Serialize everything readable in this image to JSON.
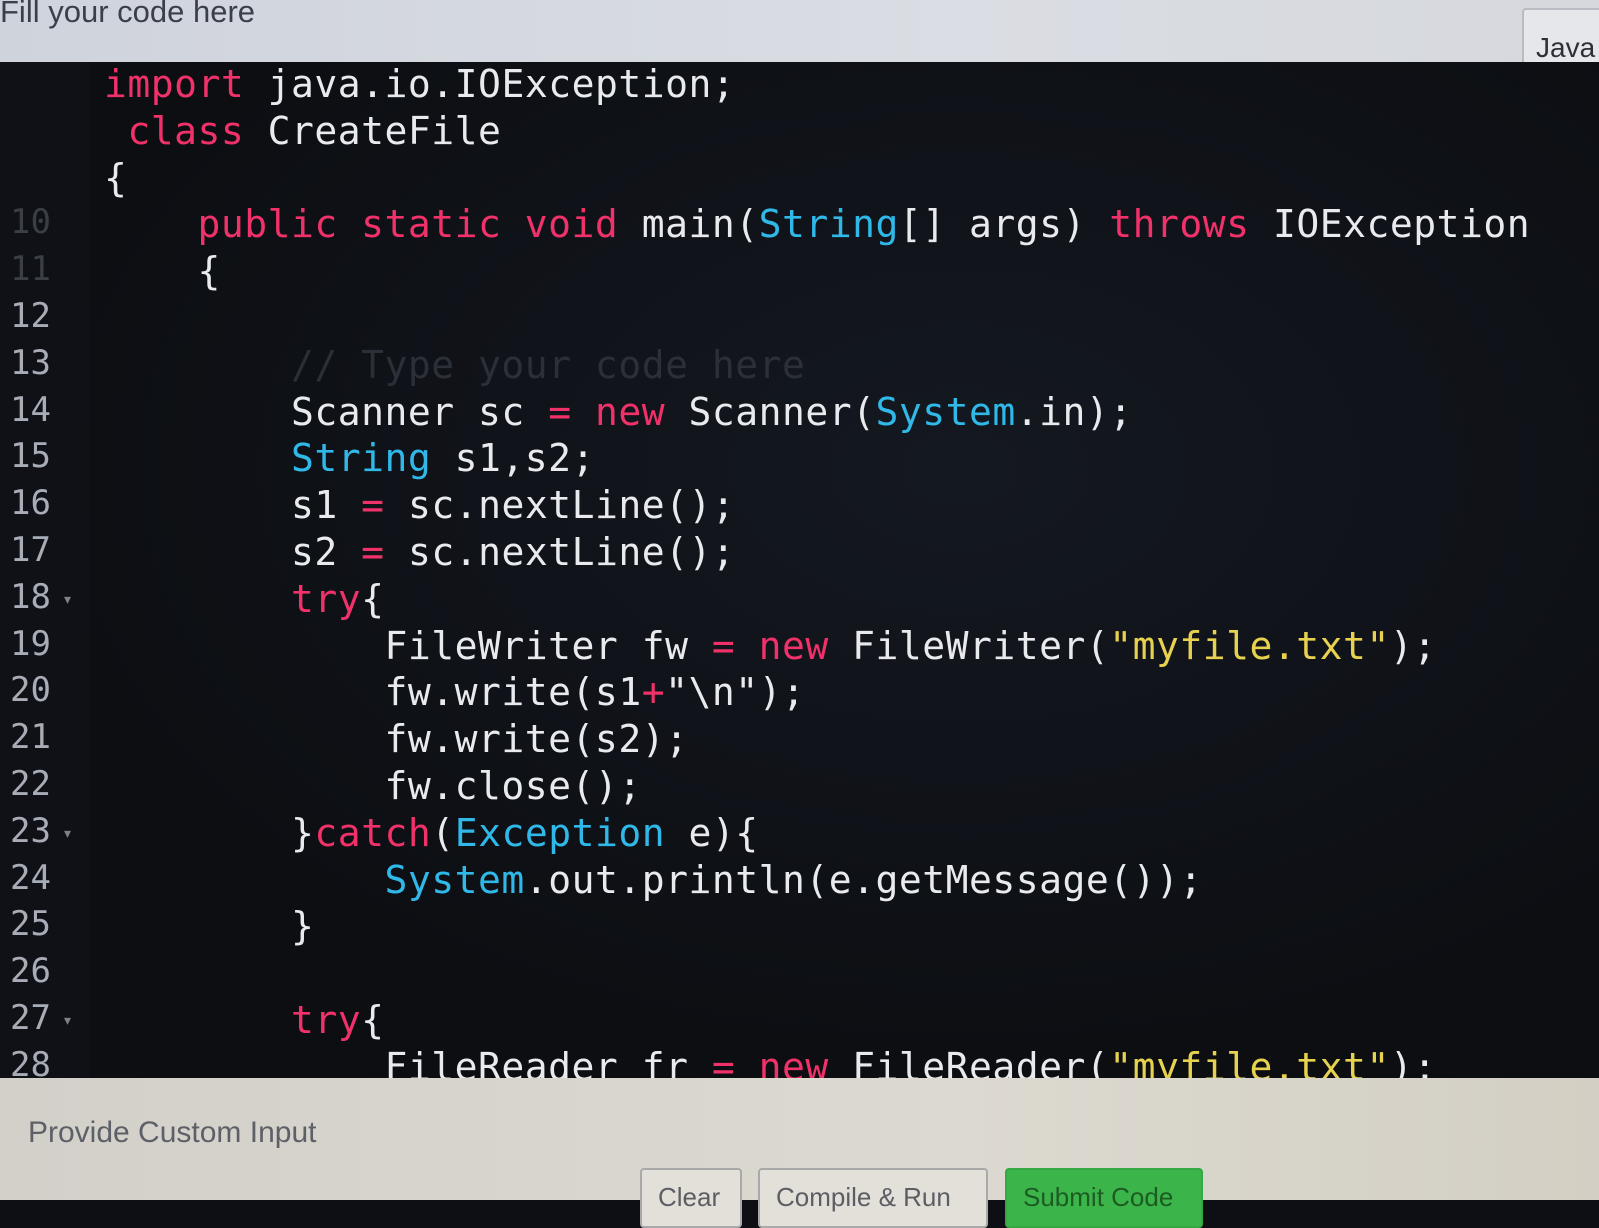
{
  "header": {
    "title": "Fill your code here",
    "language": "Java"
  },
  "editor": {
    "lines": [
      {
        "num": "",
        "tokens": [
          [
            "kw",
            "import"
          ],
          [
            "tx",
            " java.io.IOException;"
          ]
        ]
      },
      {
        "num": "",
        "tokens": [
          [
            "kw",
            " class"
          ],
          [
            "tx",
            " CreateFile"
          ]
        ]
      },
      {
        "num": "",
        "tokens": [
          [
            "tx",
            "{"
          ]
        ]
      },
      {
        "num": "10",
        "tokens": [
          [
            "kw",
            "    public static void"
          ],
          [
            "tx",
            " main("
          ],
          [
            "ty",
            "String"
          ],
          [
            "tx",
            "[] args) "
          ],
          [
            "kw",
            "throws"
          ],
          [
            "tx",
            " IOException"
          ]
        ]
      },
      {
        "num": "11",
        "tokens": [
          [
            "tx",
            "    {"
          ]
        ]
      },
      {
        "num": "12",
        "tokens": []
      },
      {
        "num": "13",
        "tokens": [
          [
            "cm",
            "        // Type your code here"
          ]
        ]
      },
      {
        "num": "14",
        "tokens": [
          [
            "tx",
            "        Scanner sc "
          ],
          [
            "kw",
            "="
          ],
          [
            "kw",
            " new"
          ],
          [
            "tx",
            " Scanner("
          ],
          [
            "ty",
            "System"
          ],
          [
            "tx",
            ".in);"
          ]
        ]
      },
      {
        "num": "15",
        "tokens": [
          [
            "ty",
            "        String"
          ],
          [
            "tx",
            " s1,s2;"
          ]
        ]
      },
      {
        "num": "16",
        "tokens": [
          [
            "tx",
            "        s1 "
          ],
          [
            "kw",
            "="
          ],
          [
            "tx",
            " sc.nextLine();"
          ]
        ]
      },
      {
        "num": "17",
        "tokens": [
          [
            "tx",
            "        s2 "
          ],
          [
            "kw",
            "="
          ],
          [
            "tx",
            " sc.nextLine();"
          ]
        ]
      },
      {
        "num": "18",
        "tokens": [
          [
            "kw",
            "        try"
          ],
          [
            "tx",
            "{"
          ]
        ]
      },
      {
        "num": "19",
        "tokens": [
          [
            "tx",
            "            FileWriter fw "
          ],
          [
            "kw",
            "="
          ],
          [
            "kw",
            " new"
          ],
          [
            "tx",
            " FileWriter("
          ],
          [
            "st",
            "\"myfile.txt\""
          ],
          [
            "tx",
            ");"
          ]
        ]
      },
      {
        "num": "20",
        "tokens": [
          [
            "tx",
            "            fw.write(s1"
          ],
          [
            "kw",
            "+"
          ],
          [
            "tx",
            "\"\\n\");"
          ]
        ]
      },
      {
        "num": "21",
        "tokens": [
          [
            "tx",
            "            fw.write(s2);"
          ]
        ]
      },
      {
        "num": "22",
        "tokens": [
          [
            "tx",
            "            fw.close();"
          ]
        ]
      },
      {
        "num": "23",
        "tokens": [
          [
            "tx",
            "        }"
          ],
          [
            "kw",
            "catch"
          ],
          [
            "tx",
            "("
          ],
          [
            "ty",
            "Exception"
          ],
          [
            "tx",
            " e){"
          ]
        ]
      },
      {
        "num": "24",
        "tokens": [
          [
            "ty",
            "            System"
          ],
          [
            "tx",
            ".out.println(e.getMessage());"
          ]
        ]
      },
      {
        "num": "25",
        "tokens": [
          [
            "tx",
            "        }"
          ]
        ]
      },
      {
        "num": "26",
        "tokens": []
      },
      {
        "num": "27",
        "tokens": [
          [
            "kw",
            "        try"
          ],
          [
            "tx",
            "{"
          ]
        ]
      },
      {
        "num": "28",
        "tokens": [
          [
            "tx",
            "            FileReader fr "
          ],
          [
            "kw",
            "="
          ],
          [
            "kw",
            " new"
          ],
          [
            "tx",
            " FileReader("
          ],
          [
            "st",
            "\"myfile.txt\""
          ],
          [
            "tx",
            ");"
          ]
        ]
      }
    ]
  },
  "footer": {
    "custom_input_label": "Provide Custom Input",
    "clear_label": "Clear",
    "run_label": "Compile & Run",
    "submit_label": "Submit Code"
  },
  "colors": {
    "keyword": "#f0316a",
    "type": "#2fb8e8",
    "string": "#e7d24f",
    "submit": "#3bb54a"
  }
}
